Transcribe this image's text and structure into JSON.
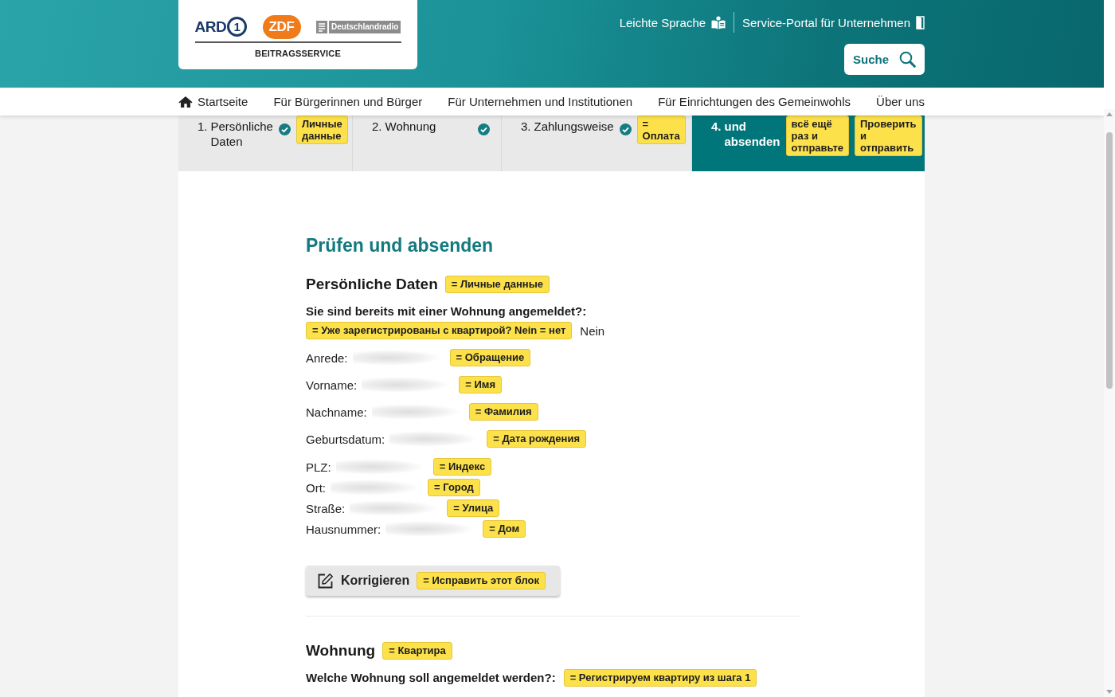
{
  "header": {
    "logo": {
      "brands": [
        {
          "kind": "ard",
          "name": "ARD",
          "mark": "1"
        },
        {
          "kind": "zdf",
          "name": "ZDF"
        },
        {
          "kind": "dlr",
          "name": "Deutschlandradio"
        }
      ],
      "service": "BEITRAGSSERVICE"
    },
    "links": [
      {
        "label": "Leichte Sprache",
        "kind": "easy_read"
      },
      {
        "label": "Service-Portal für Unternehmen",
        "kind": "portal"
      }
    ],
    "search_button": {
      "label": "Suche"
    }
  },
  "nav": [
    {
      "label": "Startseite",
      "kind": "home"
    },
    {
      "label": "Für Bürgerinnen und Bürger",
      "kind": "link"
    },
    {
      "label": "Für Unternehmen und Institutionen",
      "kind": "link"
    },
    {
      "label": "Für Einrichtungen des Gemeinwohls",
      "kind": "link"
    },
    {
      "label": "Über uns",
      "kind": "link"
    }
  ],
  "stepper": [
    {
      "number": "1.",
      "label": "Persönliche Daten",
      "done": true,
      "selected": false,
      "notes": [
        "Личные данные"
      ]
    },
    {
      "number": "2.",
      "label": "Wohnung",
      "done": true,
      "selected": false
    },
    {
      "number": "3.",
      "label": "Zahlungsweise",
      "done": true,
      "selected": false,
      "notes": [
        "= Оплата"
      ]
    },
    {
      "number": "4.",
      "label": "und absenden",
      "done": false,
      "selected": true,
      "notes": [
        "всё ещё раз и отправьте",
        "Проверить и отправить"
      ]
    }
  ],
  "main": {
    "title": "Prüfen und absenden",
    "sections": [
      {
        "title": "Persönliche Daten",
        "note": "= Личные данные",
        "question": {
          "label": "Sie sind bereits mit einer Wohnung angemeldet?:",
          "note": "= Уже зарегистрированы с квартирой? Nein = нет",
          "answer": "Nein"
        },
        "field_groups": [
          [
            {
              "label": "Anrede:",
              "redacted": true,
              "note": "= Обращение"
            },
            {
              "label": "Vorname:",
              "redacted": true,
              "note": "= Имя"
            },
            {
              "label": "Nachname:",
              "redacted": true,
              "note": "= Фамилия"
            },
            {
              "label": "Geburtsdatum:",
              "redacted": true,
              "note": "= Дата рождения"
            }
          ],
          [
            {
              "label": "PLZ:",
              "redacted": true,
              "note": "= Индекс"
            },
            {
              "label": "Ort:",
              "redacted": true,
              "note": "= Город"
            },
            {
              "label": "Straße:",
              "redacted": true,
              "note": "= Улица"
            },
            {
              "label": "Hausnummer:",
              "redacted": true,
              "note": "= Дом"
            }
          ]
        ],
        "edit_button": {
          "label": "Korrigieren",
          "note": "= Исправить этот блок"
        }
      },
      {
        "title": "Wohnung",
        "note": "= Квартира",
        "question": {
          "label": "Welche Wohnung soll angemeldet werden?:",
          "note": "= Регистрируем квартиру из шага 1"
        }
      }
    ]
  }
}
